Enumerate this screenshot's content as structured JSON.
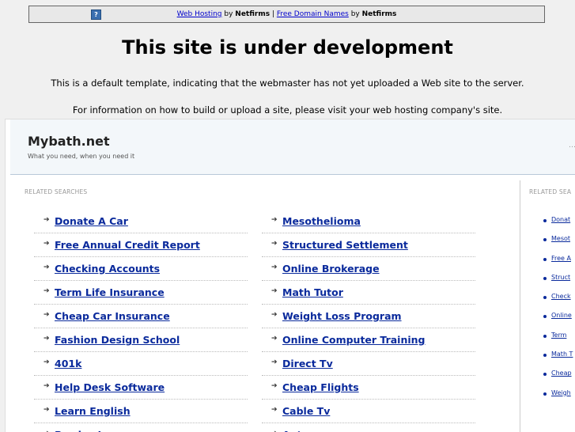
{
  "banner": {
    "help_icon": "?",
    "link1": "Web Hosting",
    "by1": " by ",
    "brand1": "Netfirms",
    "sep": " | ",
    "link2": "Free Domain Names",
    "by2": " by ",
    "brand2": "Netfirms"
  },
  "headline": "This site is under development",
  "info_line1": "This is a default template, indicating that the webmaster has not yet uploaded a Web site to the server.",
  "info_line2": "For information on how to build or upload a site, please visit your web hosting company's site.",
  "site": {
    "title": "Mybath.net",
    "tagline": "What you need, when you need it",
    "edge_mark": "…"
  },
  "main": {
    "section_label": "RELATED SEARCHES",
    "left_links": [
      "Donate A Car",
      "Free Annual Credit Report",
      "Checking Accounts",
      "Term Life Insurance",
      "Cheap Car Insurance",
      "Fashion Design School",
      "401k",
      "Help Desk Software",
      "Learn English",
      "Payday Loan"
    ],
    "right_links": [
      "Mesothelioma",
      "Structured Settlement",
      "Online Brokerage",
      "Math Tutor",
      "Weight Loss Program",
      "Online Computer Training",
      "Direct Tv",
      "Cheap Flights",
      "Cable Tv",
      "Autos"
    ]
  },
  "sidebar": {
    "section_label": "RELATED SEA",
    "links": [
      "Donat",
      "Mesot",
      "Free A",
      "Struct",
      "Check",
      "Online",
      "Term",
      "Math T",
      "Cheap",
      "Weigh"
    ]
  },
  "colors": {
    "link": "#0a2a9c",
    "background": "#f0f0f0"
  },
  "icons": {
    "bullet": "right-arrow-icon",
    "help": "help-icon"
  }
}
